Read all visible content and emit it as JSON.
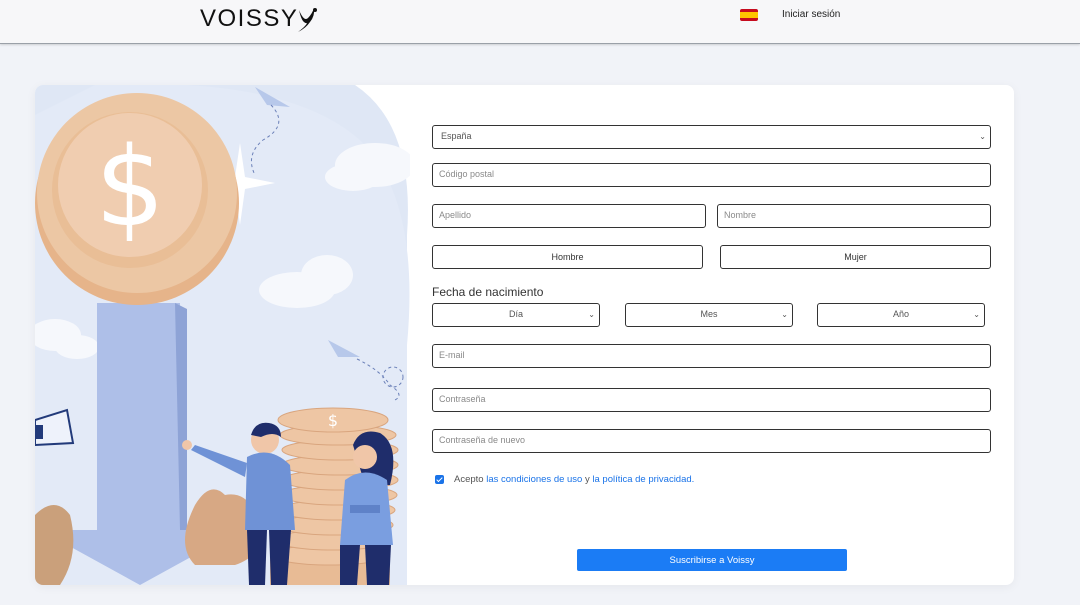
{
  "header": {
    "brand": "VOISSY",
    "language_flag": "spain-flag-icon",
    "login_label": "Iniciar sesión"
  },
  "form": {
    "country": {
      "value": "España"
    },
    "postal_code": {
      "placeholder": "Código postal"
    },
    "last_name": {
      "placeholder": "Apellido"
    },
    "first_name": {
      "placeholder": "Nombre"
    },
    "gender": {
      "male_label": "Hombre",
      "female_label": "Mujer"
    },
    "dob": {
      "label": "Fecha de nacimiento",
      "day": "Día",
      "month": "Mes",
      "year": "Año"
    },
    "email": {
      "placeholder": "E-mail"
    },
    "password": {
      "placeholder": "Contraseña"
    },
    "password_confirm": {
      "placeholder": "Contraseña de nuevo"
    },
    "terms": {
      "checked": true,
      "prefix": "Acepto ",
      "conditions_link": "las condiciones de uso",
      "middle": " y ",
      "privacy_link": "la política de privacidad."
    },
    "submit_label": "Suscribirse a Voissy"
  },
  "colors": {
    "accent": "#1b7cf5",
    "coin": "#ecc7a4",
    "arrow": "#a9bde6",
    "background": "#f1f3f8"
  }
}
